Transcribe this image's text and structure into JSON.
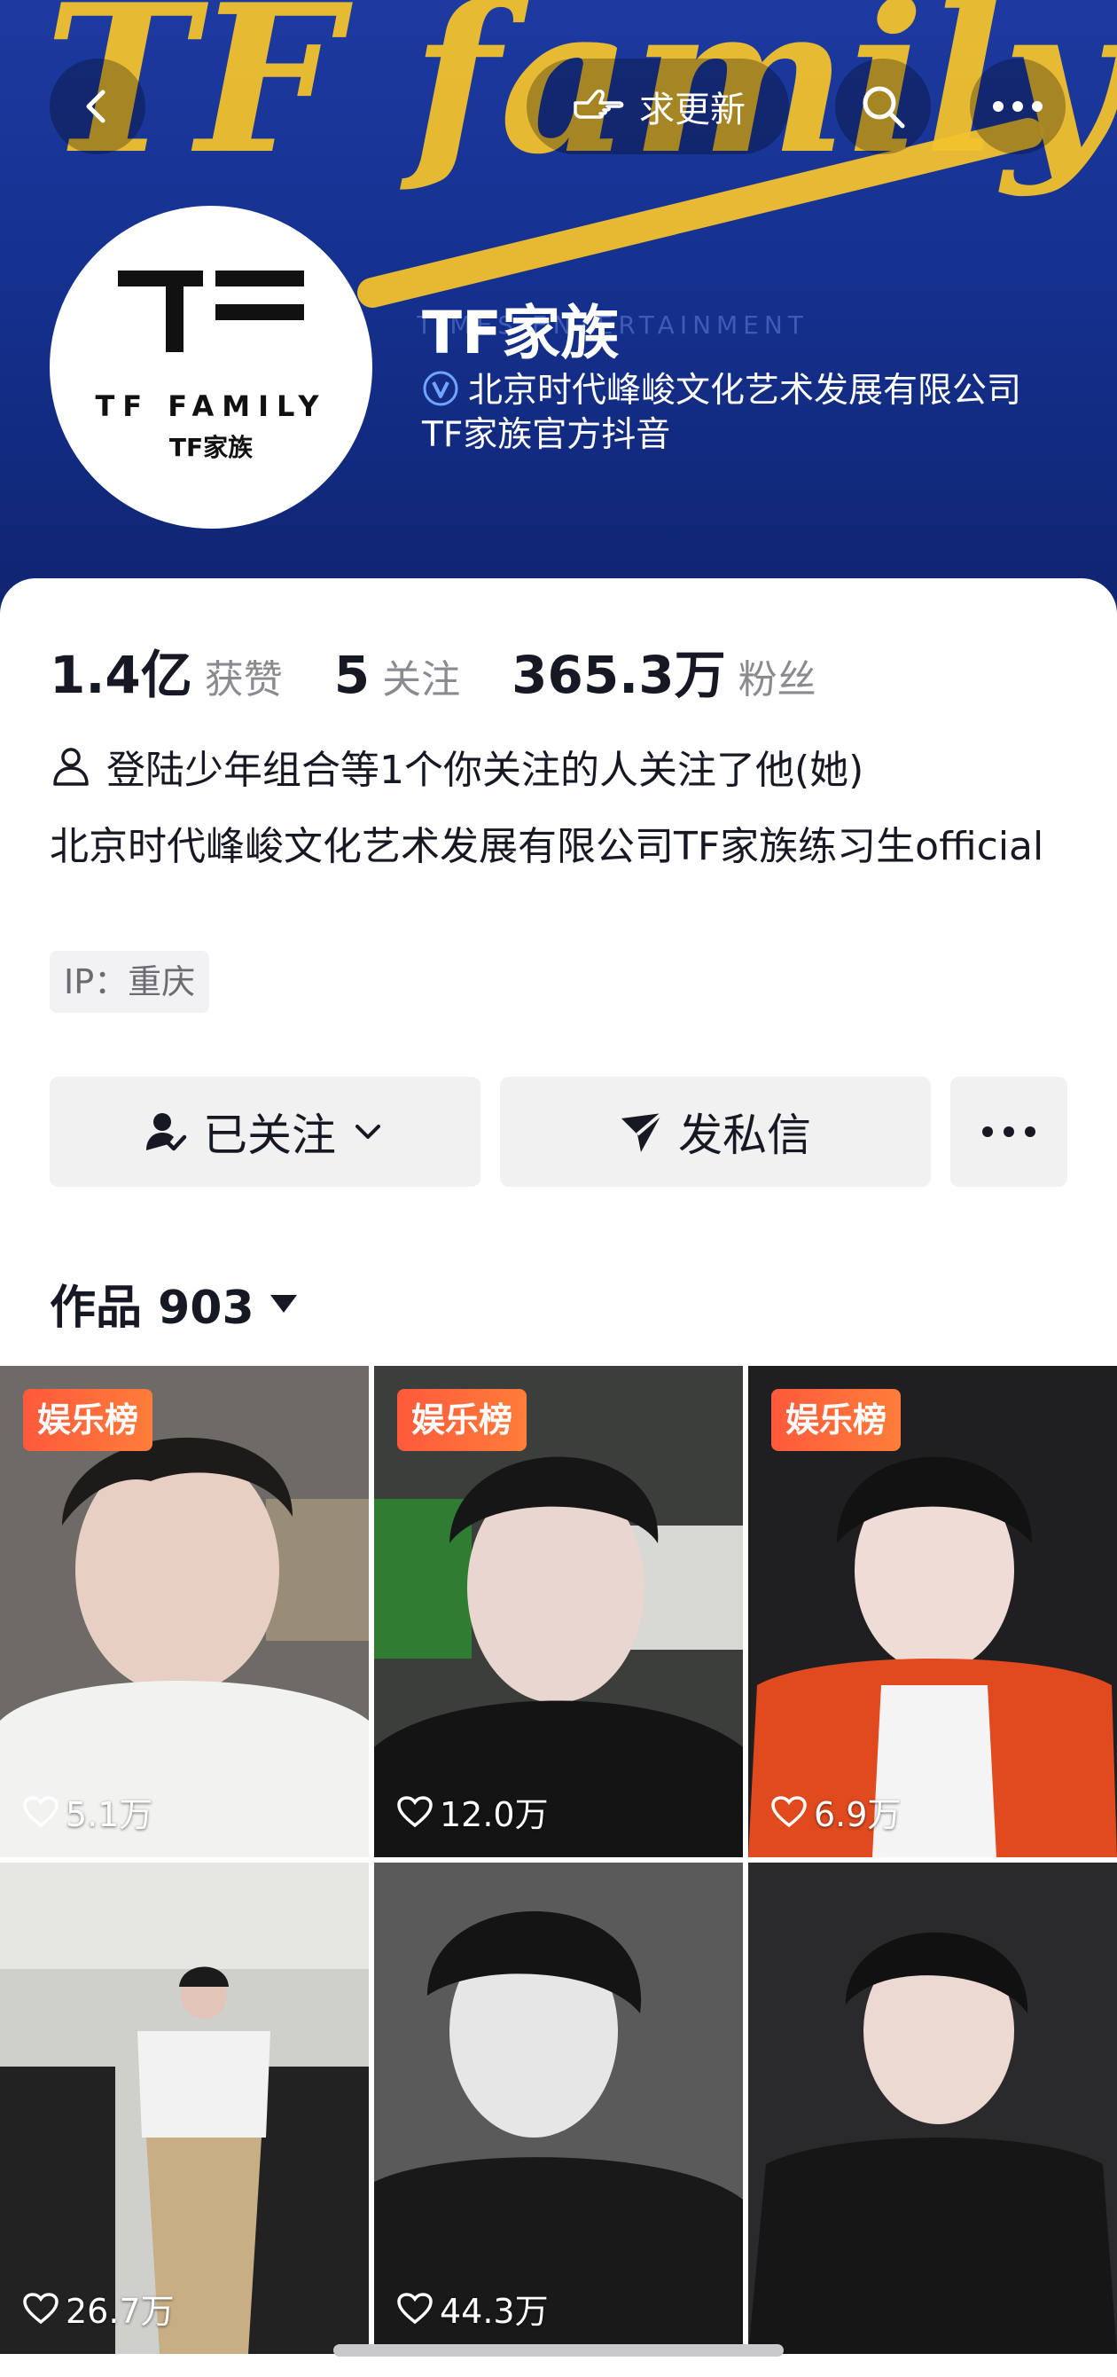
{
  "header": {
    "back_icon": "back-arrow-icon",
    "update_label": "求更新",
    "update_icon": "hand-pointing-icon",
    "search_icon": "search-icon",
    "more_icon": "more-dots-icon",
    "banner_text": "TF family",
    "banner_subtext": "TIMES ENTERTAINMENT"
  },
  "profile": {
    "avatar_brand": "TF FAMILY",
    "avatar_cn": "TF家族",
    "name": "TF家族",
    "verification": "北京时代峰峻文化艺术发展有限公司TF家族官方抖音",
    "stats": [
      {
        "num": "1.4亿",
        "label": "获赞"
      },
      {
        "num": "5",
        "label": "关注"
      },
      {
        "num": "365.3万",
        "label": "粉丝"
      }
    ],
    "followed_by": "登陆少年组合等1个你关注的人关注了他(她)",
    "bio": "北京时代峰峻文化艺术发展有限公司TF家族练习生official",
    "ip": "IP：重庆"
  },
  "actions": {
    "follow_label": "已关注",
    "message_label": "发私信"
  },
  "works": {
    "tab_label": "作品 903"
  },
  "videos": [
    {
      "badge": "娱乐榜",
      "likes": "5.1万"
    },
    {
      "badge": "娱乐榜",
      "likes": "12.0万"
    },
    {
      "badge": "娱乐榜",
      "likes": "6.9万"
    },
    {
      "badge": "",
      "likes": "26.7万"
    },
    {
      "badge": "",
      "likes": "44.3万"
    },
    {
      "badge": "",
      "likes": ""
    }
  ],
  "colors": {
    "banner": "#15318f",
    "accent_gold": "#f2c12e",
    "badge": "#ff5a3c"
  }
}
